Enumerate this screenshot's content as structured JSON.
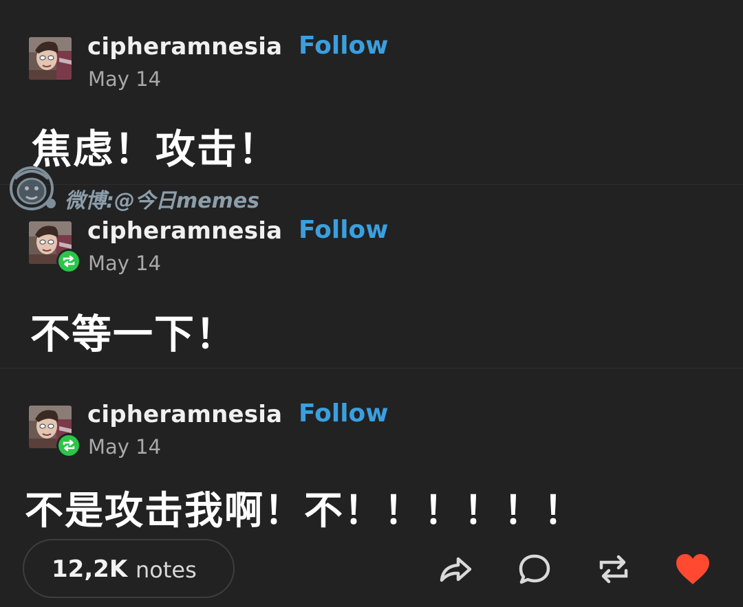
{
  "posts": [
    {
      "username": "cipheramnesia",
      "follow_label": "Follow",
      "date": "May 14",
      "text": "焦虑！攻击！",
      "is_reblog": false
    },
    {
      "username": "cipheramnesia",
      "follow_label": "Follow",
      "date": "May 14",
      "text": "不等一下！",
      "is_reblog": true
    },
    {
      "username": "cipheramnesia",
      "follow_label": "Follow",
      "date": "May 14",
      "text": "不是攻击我啊！不！！！！！！",
      "is_reblog": true
    }
  ],
  "watermark": {
    "text": "微博:@今日memes",
    "icon": "cartoon-mascot-icon"
  },
  "footer": {
    "notes_count": "12,2K",
    "notes_label": "notes",
    "actions": [
      {
        "name": "share",
        "icon": "share-arrow-icon"
      },
      {
        "name": "reply",
        "icon": "speech-bubble-icon"
      },
      {
        "name": "reblog",
        "icon": "reblog-arrows-icon"
      },
      {
        "name": "like",
        "icon": "heart-icon",
        "active": true
      }
    ]
  },
  "colors": {
    "background": "#222222",
    "username": "#f0f0f0",
    "follow": "#3a9fe0",
    "date": "#a9a9a9",
    "reblog_badge": "#2bc54a",
    "heart": "#ff4930",
    "icon": "#d9d9d9"
  }
}
